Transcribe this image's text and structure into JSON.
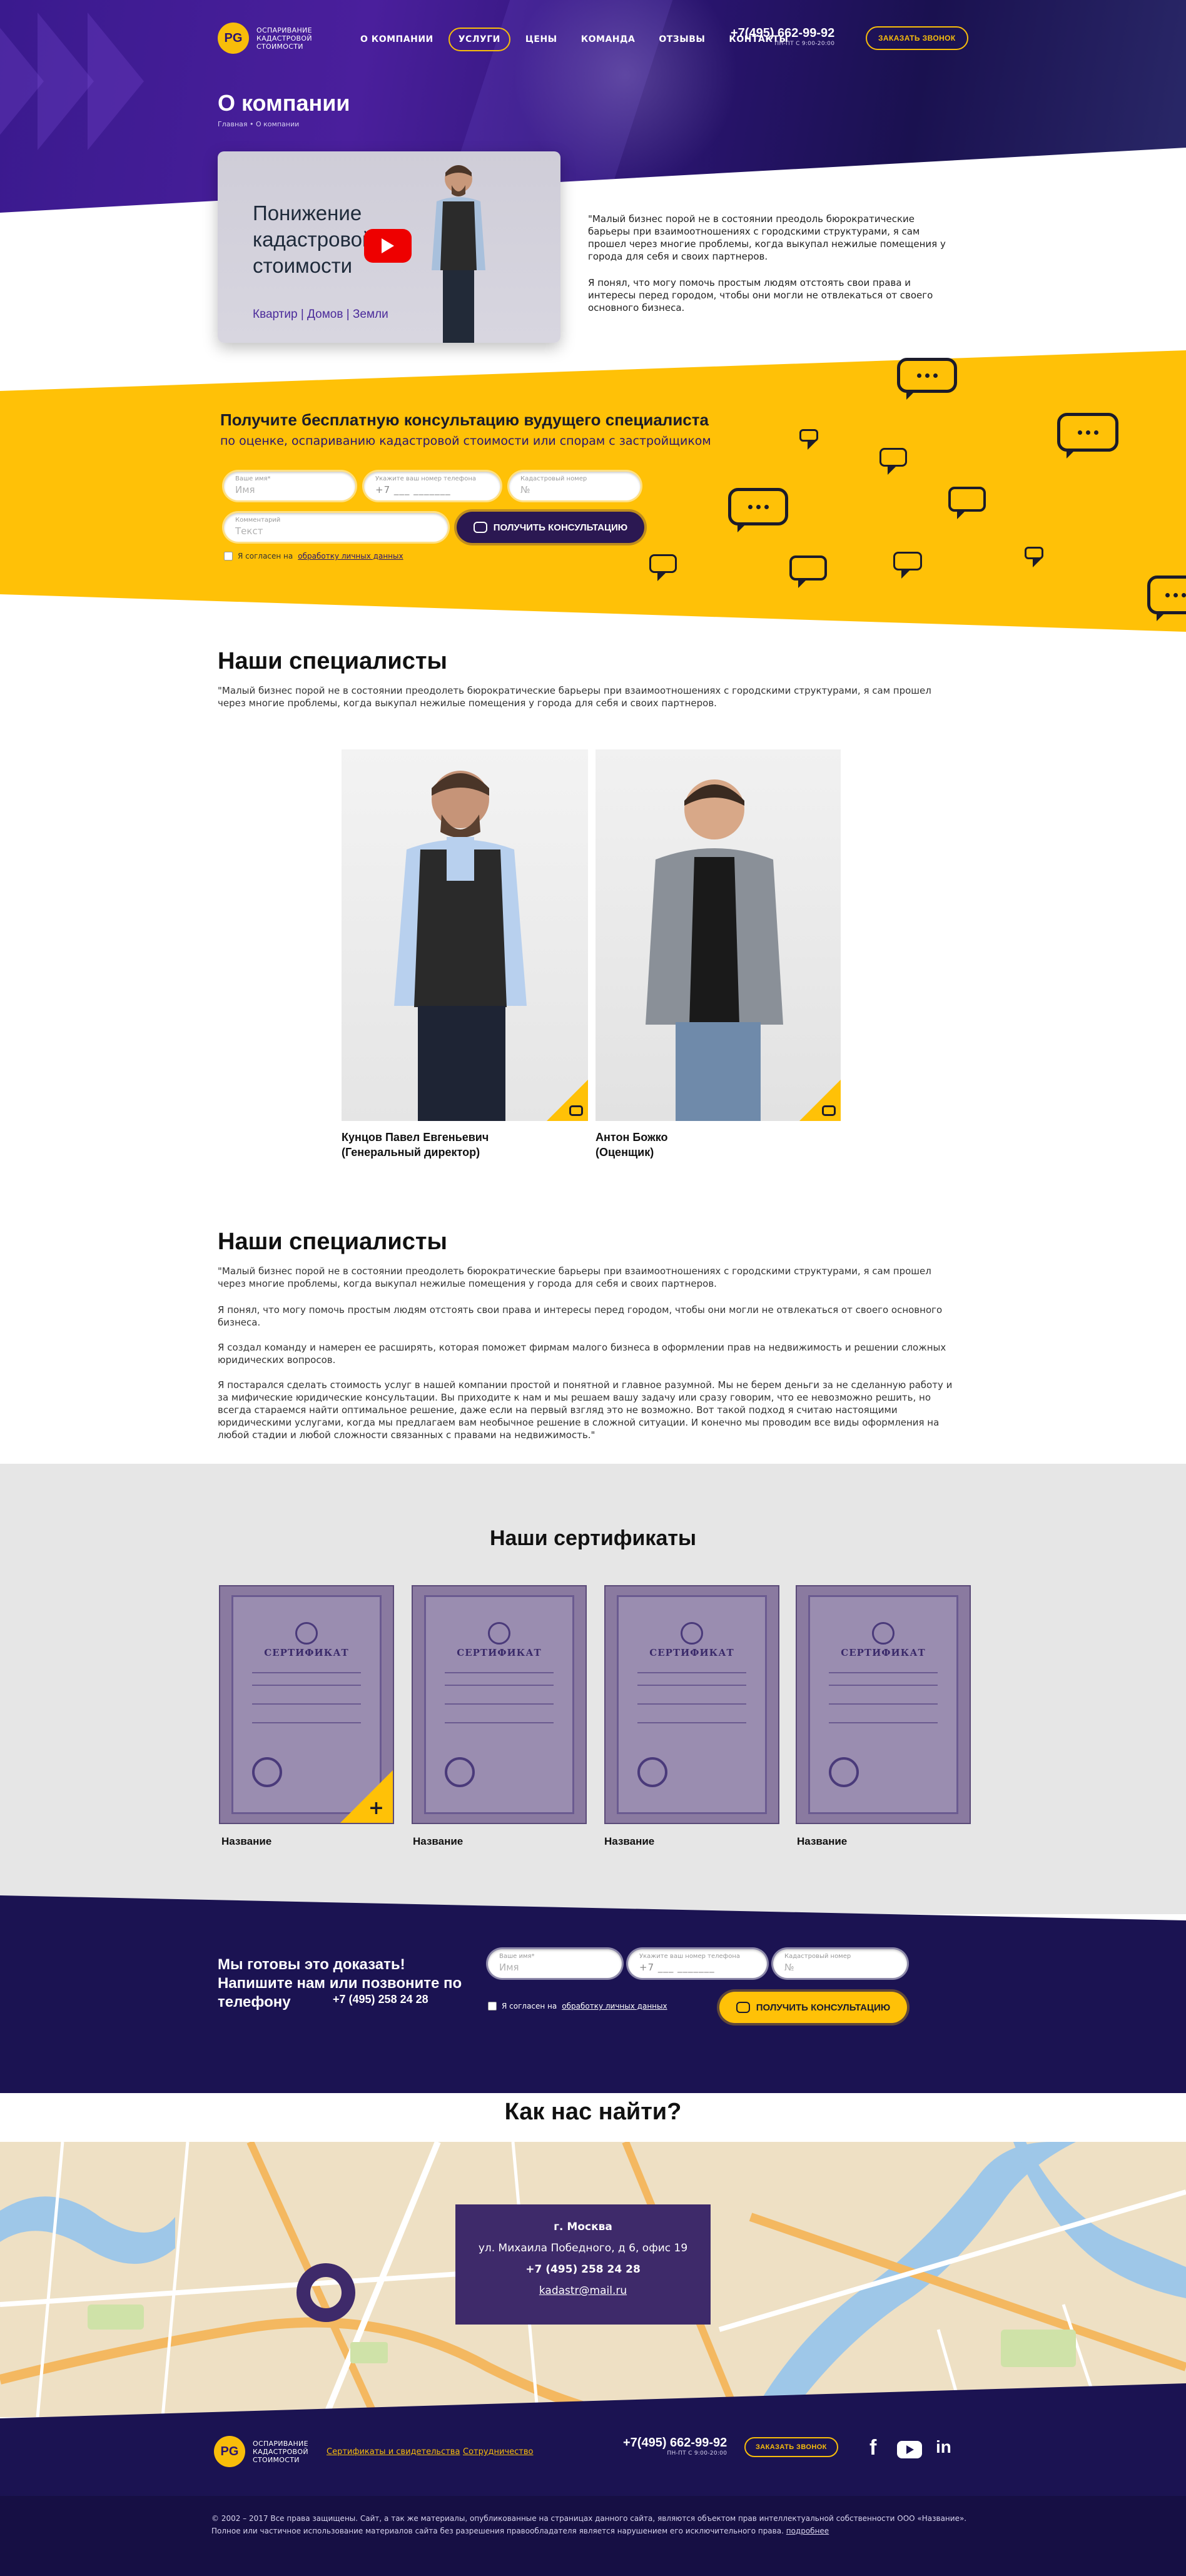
{
  "header": {
    "logo_badge": "PG",
    "logo_text": "Оспаривание кадастровой стоимости",
    "nav": [
      "О КОМПАНИИ",
      "УСЛУГИ",
      "ЦЕНЫ",
      "КОМАНДА",
      "ОТЗЫВЫ",
      "КОНТАКТЫ"
    ],
    "phone": "+7(495) 662-99-92",
    "hours": "ПН-ПТ С 9:00-20:00",
    "call_button": "ЗАКАЗАТЬ ЗВОНОК"
  },
  "hero": {
    "title": "О компании",
    "breadcrumb": "Главная • О компании",
    "video_title": "Понижение кадастровой стоимости",
    "video_sub": "Квартир | Домов | Земли",
    "text_p1": "\"Малый бизнес порой не в состоянии преодоль бюрократические барьеры при взаимоотношениях с городскими структурами, я сам прошел через многие проблемы, когда выкупал нежилые помещения у города для себя и своих партнеров.",
    "text_p2": "Я понял, что могу помочь простым людям отстоять свои права и интересы перед городом, чтобы они могли не отвлекаться от своего основного бизнеса."
  },
  "consult": {
    "heading": "Получите бесплатную консультацию вудущего специалиста",
    "subheading": "по оценке, оспариванию кадастровой стоимости или спорам с застройщиком",
    "name_label": "Ваше имя*",
    "name_ph": "Имя",
    "phone_label": "Укажите ваш номер телефона",
    "phone_ph": "+7 ___ _______",
    "cad_label": "Кадастровый номер",
    "cad_ph": "№",
    "comment_label": "Комментарий",
    "comment_ph": "Текст",
    "button": "ПОЛУЧИТЬ КОНСУЛЬТАЦИЮ",
    "agree": "Я согласен на",
    "agree_link": "обработку личных данных"
  },
  "specialists": {
    "heading": "Наши специалисты",
    "text": "\"Малый бизнес порой не в состоянии преодолеть бюрократические барьеры при взаимоотношениях с городскими структурами, я сам прошел через многие проблемы, когда выкупал нежилые помещения у города для себя и своих партнеров.",
    "people": [
      {
        "name": "Кунцов Павел Евгеньевич",
        "role": "(Генеральный директор)"
      },
      {
        "name": "Антон Божко",
        "role": "(Оценщик)"
      }
    ]
  },
  "specialists2": {
    "heading": "Наши специалисты",
    "p1": "\"Малый бизнес порой не в состоянии преодолеть бюрократические барьеры при взаимоотношениях с городскими структурами, я сам прошел через многие проблемы, когда выкупал нежилые помещения у города для себя и своих партнеров.",
    "p2": "Я понял, что могу помочь простым людям отстоять свои права и интересы перед городом, чтобы они могли не отвлекаться от своего основного бизнеса.",
    "p3": " Я создал команду и намерен ее расширять, которая поможет фирмам малого бизнеса в оформлении прав на недвижимость и решении сложных юридических вопросов.",
    "p4": "Я постарался сделать стоимость услуг в нашей компании простой и понятной и главное разумной. Мы не берем деньги за не сделанную работу и за мифические юридические консультации. Вы приходите к нам и мы решаем вашу задачу или сразу говорим, что ее невозможно решить, но всегда стараемся найти оптимальное решение, даже если на первый взгляд это не возможно. Вот такой подход я считаю настоящими юридическими услугами, когда мы предлагаем вам необычное решение в сложной ситуации. И конечно мы проводим все виды оформления на любой стадии и любой сложности связанных с правами на недвижимость.\""
  },
  "certificates": {
    "heading": "Наши сертификаты",
    "cert_word": "СЕРТИФИКАТ",
    "items": [
      "Название",
      "Название",
      "Название",
      "Название"
    ]
  },
  "prove": {
    "heading": "Мы готовы это доказать! Напишите нам или позвоните по телефону",
    "phone": "+7 (495) 258 24 28",
    "name_label": "Ваше имя*",
    "name_ph": "Имя",
    "phone_label": "Укажите ваш номер телефона",
    "phone_ph": "+7 ___ _______",
    "cad_label": "Кадастровый номер",
    "cad_ph": "№",
    "agree": "Я согласен на",
    "agree_link": "обработку личных данных",
    "button": "ПОЛУЧИТЬ КОНСУЛЬТАЦИЮ"
  },
  "find": {
    "heading": "Как нас найти?",
    "city": "г. Москва",
    "address": "ул. Михаила Победного, д 6, офис 19",
    "phone": "+7 (495) 258 24 28",
    "email": "kadastr@mail.ru"
  },
  "footer": {
    "link1": "Сертификаты и свидетельства",
    "link2": "Сотрудничество",
    "phone": "+7(495) 662-99-92",
    "hours": "ПН-ПТ С 9:00-20:00",
    "call_button": "ЗАКАЗАТЬ ЗВОНОК",
    "copy1": "© 2002 – 2017 Все права защищены. Сайт, а так же материалы, опубликованные на страницах данного сайта, являются объектом прав интеллектуальной собственности ООО «Название».",
    "copy2": "Полное или частичное использование материалов сайта без разрешения правообладателя является нарушением его исключительного права.",
    "copy_link": "подробнее"
  },
  "colors": {
    "accent": "#f8bd0a",
    "dark": "#1b1352",
    "purple": "#3a1a8e"
  }
}
